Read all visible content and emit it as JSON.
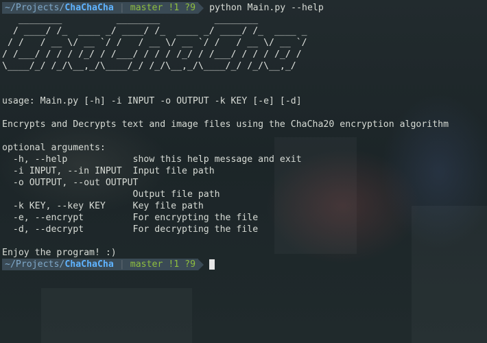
{
  "prompt": {
    "path_prefix": "~/Projects/",
    "path_dir": "ChaChaCha",
    "separator": "|",
    "git_branch": "master",
    "git_status": "!1 ?9"
  },
  "command": "python Main.py --help",
  "banner": [
    "   ________          ________          ________",
    "  / ____/ /_  ____ _/ ____/ /_  ____ _/ ____/ /_  ____ _",
    " / /   / __ \\/ __ `/ /   / __ \\/ __ `/ /   / __ \\/ __ `/",
    "/ /___/ / / / /_/ / /___/ / / / /_/ / /___/ / / / /_/ /",
    "\\____/_/ /_/\\__,_/\\____/_/ /_/\\__,_/\\____/_/ /_/\\__,_/"
  ],
  "usage": "usage: Main.py [-h] -i INPUT -o OUTPUT -k KEY [-e] [-d]",
  "description": "Encrypts and Decrypts text and image files using the ChaCha20 encryption algorithm",
  "optional_header": "optional arguments:",
  "options": [
    "  -h, --help            show this help message and exit",
    "  -i INPUT, --in INPUT  Input file path",
    "  -o OUTPUT, --out OUTPUT",
    "                        Output file path",
    "  -k KEY, --key KEY     Key file path",
    "  -e, --encrypt         For encrypting the file",
    "  -d, --decrypt         For decrypting the file"
  ],
  "closing": "Enjoy the program! :)",
  "colors": {
    "prompt_bg": "#3a4a55",
    "path_dir": "#5fb3ff",
    "git": "#8fbf3f"
  }
}
